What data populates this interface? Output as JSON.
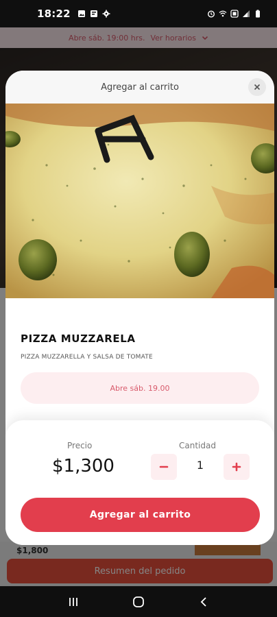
{
  "status_bar": {
    "time": "18:22"
  },
  "background": {
    "top_banner": "Abre sáb. 19:00 hrs.",
    "top_banner_link": "Ver horarios",
    "price_preview": "$1,800",
    "summary_button": "Resumen del pedido"
  },
  "modal": {
    "title": "Agregar al carrito",
    "product_name": "PIZZA MUZZARELA",
    "product_description": "PIZZA MUZZARELLA Y SALSA DE TOMATE",
    "schedule_notice": "Abre sáb. 19.00",
    "price_label": "Precio",
    "price_value": "$1,300",
    "quantity_label": "Cantidad",
    "quantity_value": "1",
    "add_button": "Agregar al carrito"
  },
  "colors": {
    "accent": "#e23e4d",
    "accent_light": "#fdeef0",
    "schedule_text": "#d85a6b"
  },
  "icons": {
    "close": "close-icon",
    "minus": "minus-icon",
    "plus": "plus-icon",
    "chevron": "chevron-down-icon",
    "nav_recent": "recent-apps-icon",
    "nav_home": "home-icon",
    "nav_back": "back-icon"
  }
}
